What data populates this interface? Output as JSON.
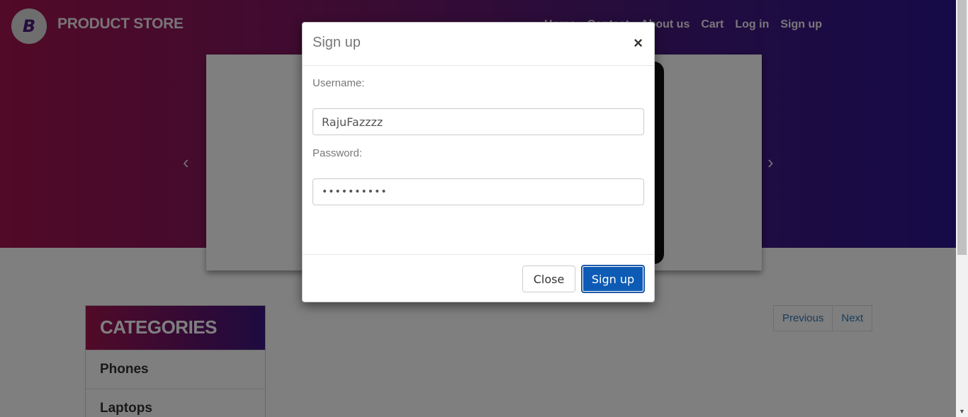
{
  "brand": {
    "logo_letter": "B",
    "name": "PRODUCT STORE"
  },
  "nav": {
    "items": [
      {
        "label": "Home"
      },
      {
        "label": "Contact"
      },
      {
        "label": "About us"
      },
      {
        "label": "Cart"
      },
      {
        "label": "Log in"
      },
      {
        "label": "Sign up"
      }
    ]
  },
  "carousel": {
    "prev_icon": "‹",
    "next_icon": "›"
  },
  "categories": {
    "title": "CATEGORIES",
    "items": [
      "Phones",
      "Laptops"
    ]
  },
  "pagination": {
    "previous": "Previous",
    "next": "Next"
  },
  "modal": {
    "title": "Sign up",
    "close_icon": "×",
    "username_label": "Username:",
    "username_value": "RajuFazzzz",
    "password_label": "Password:",
    "password_value": "••••••••••",
    "close_button": "Close",
    "signup_button": "Sign up"
  },
  "colors": {
    "primary_button": "#0d5bb5",
    "header_start": "#a3144f",
    "header_end": "#2b1590"
  }
}
